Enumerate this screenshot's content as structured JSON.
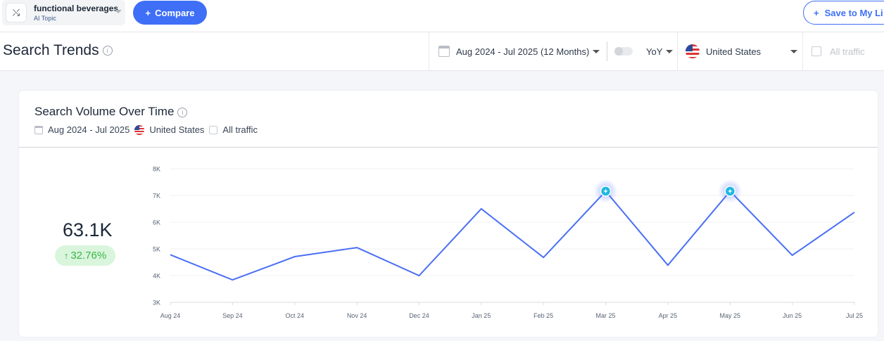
{
  "topbar": {
    "topic_name": "functional beverages",
    "topic_type": "AI Topic",
    "compare_label": "Compare",
    "save_label": "Save to My Li"
  },
  "header": {
    "title": "Search Trends",
    "date_range": "Aug 2024 - Jul 2025 (12 Months)",
    "compare_mode": "YoY",
    "country": "United States",
    "traffic": "All traffic"
  },
  "card": {
    "title": "Search Volume Over Time",
    "meta_date": "Aug 2024 - Jul 2025",
    "meta_country": "United States",
    "meta_traffic": "All traffic",
    "total": "63.1K",
    "change": "32.76%",
    "change_color": "#3cb54a"
  },
  "colors": {
    "accent": "#3e6ff6",
    "line": "#4a6ff5",
    "marker": "#1eb8e0"
  },
  "chart_data": {
    "type": "line",
    "categories": [
      "Aug 24",
      "Sep 24",
      "Oct 24",
      "Nov 24",
      "Dec 24",
      "Jan 25",
      "Feb 25",
      "Mar 25",
      "Apr 25",
      "May 25",
      "Jun 25",
      "Jul 25"
    ],
    "values": [
      4780,
      3840,
      4710,
      5050,
      4000,
      6500,
      4680,
      7160,
      4390,
      7160,
      4760,
      6370
    ],
    "ylim": [
      3000,
      8000
    ],
    "yticks": [
      3000,
      4000,
      5000,
      6000,
      7000,
      8000
    ],
    "ytick_labels": [
      "3K",
      "4K",
      "5K",
      "6K",
      "7K",
      "8K"
    ],
    "markers": [
      "Mar 25",
      "May 25"
    ],
    "grid": true
  }
}
